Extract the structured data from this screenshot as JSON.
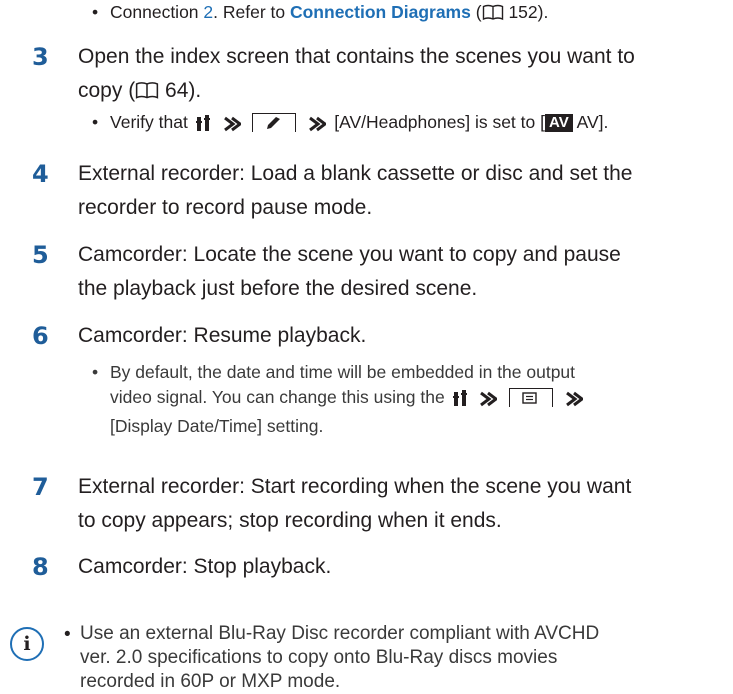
{
  "pre_bullet": {
    "text_a": "Connection ",
    "conn_num": "2",
    "text_b": ". Refer to ",
    "link": "Connection Diagrams",
    "text_c": " (",
    "page": "152",
    "text_d": ")."
  },
  "steps": [
    {
      "num": "3",
      "line1": "Open the index screen that contains the scenes you want to",
      "line2a": "copy (",
      "page": "64",
      "line2b": ")."
    },
    {
      "num": "4",
      "line1": "External recorder: Load a blank cassette or disc and set the",
      "line2": "recorder to record pause mode."
    },
    {
      "num": "5",
      "line1": "Camcorder: Locate the scene you want to copy and pause",
      "line2": "the playback just before the desired scene."
    },
    {
      "num": "6",
      "line1": "Camcorder: Resume playback."
    },
    {
      "num": "7",
      "line1": "External recorder: Start recording when the scene you want",
      "line2": "to copy appears; stop recording when it ends."
    },
    {
      "num": "8",
      "line1": "Camcorder: Stop playback."
    }
  ],
  "bullet_step3": {
    "a": "Verify that",
    "b": "[AV/Headphones] is set to [",
    "av_badge": "AV",
    "c": " AV]."
  },
  "bullet_step6": {
    "line1": "By default, the date and time will be embedded in the output",
    "line2a": "video signal. You can change this using the",
    "line3": "[Display Date/Time] setting."
  },
  "note": {
    "icon_glyph": "i",
    "line1": "Use an external Blu-Ray Disc recorder compliant with AVCHD",
    "line2": "ver. 2.0 specifications to copy onto Blu-Ray discs movies",
    "line3": "recorded in 60P or MXP mode."
  },
  "colors": {
    "accent": "#1f6fb5",
    "step_number": "#1f5d99",
    "text": "#231f20"
  },
  "icons": [
    "book-icon",
    "menu-icon",
    "arrow-icon",
    "setup-tab-icon",
    "display-tab-icon",
    "info-icon"
  ]
}
